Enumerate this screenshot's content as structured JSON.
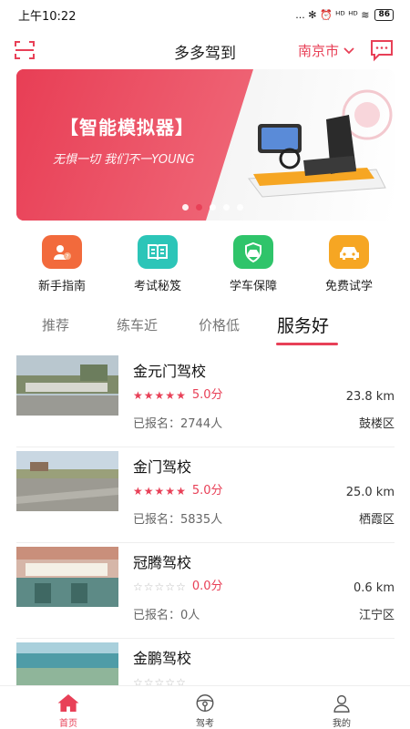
{
  "status_bar": {
    "time": "上午10:22",
    "icons_text": "... ✻ ⏰ ᴴᴰ ᴴᴰ ≋",
    "battery": "86"
  },
  "header": {
    "title": "多多驾到",
    "city": "南京市",
    "scan_icon": "scan-icon",
    "message_icon": "message-icon"
  },
  "banner": {
    "title": "【智能模拟器】",
    "slogan": "无惧一切 我们不一YOUNG",
    "slide_count": 5,
    "active_slide": 1
  },
  "quick_nav": [
    {
      "label": "新手指南",
      "icon": "guide-user-icon",
      "color": "#f26a3c"
    },
    {
      "label": "考试秘笈",
      "icon": "book-icon",
      "color": "#2cc5b8"
    },
    {
      "label": "学车保障",
      "icon": "shield-car-icon",
      "color": "#2fc46a"
    },
    {
      "label": "免费试学",
      "icon": "car-icon",
      "color": "#f6a623"
    }
  ],
  "tabs": [
    {
      "label": "推荐",
      "active": false
    },
    {
      "label": "练车近",
      "active": false
    },
    {
      "label": "价格低",
      "active": false
    },
    {
      "label": "服务好",
      "active": true
    }
  ],
  "schools": [
    {
      "name": "金元门驾校",
      "rating_stars": 5,
      "score": "5.0分",
      "distance": "23.8 km",
      "signed": "已报名：2744人",
      "district": "鼓楼区"
    },
    {
      "name": "金门驾校",
      "rating_stars": 5,
      "score": "5.0分",
      "distance": "25.0 km",
      "signed": "已报名：5835人",
      "district": "栖霞区"
    },
    {
      "name": "冠腾驾校",
      "rating_stars": 0,
      "score": "0.0分",
      "distance": "0.6 km",
      "signed": "已报名：0人",
      "district": "江宁区"
    },
    {
      "name": "金鹏驾校",
      "rating_stars": 0,
      "score": "",
      "distance": "",
      "signed": "",
      "district": ""
    }
  ],
  "tabbar": [
    {
      "label": "首页",
      "icon": "home-icon",
      "active": true
    },
    {
      "label": "驾考",
      "icon": "steering-wheel-icon",
      "active": false
    },
    {
      "label": "我的",
      "icon": "user-icon",
      "active": false
    }
  ],
  "colors": {
    "accent": "#e84057"
  }
}
